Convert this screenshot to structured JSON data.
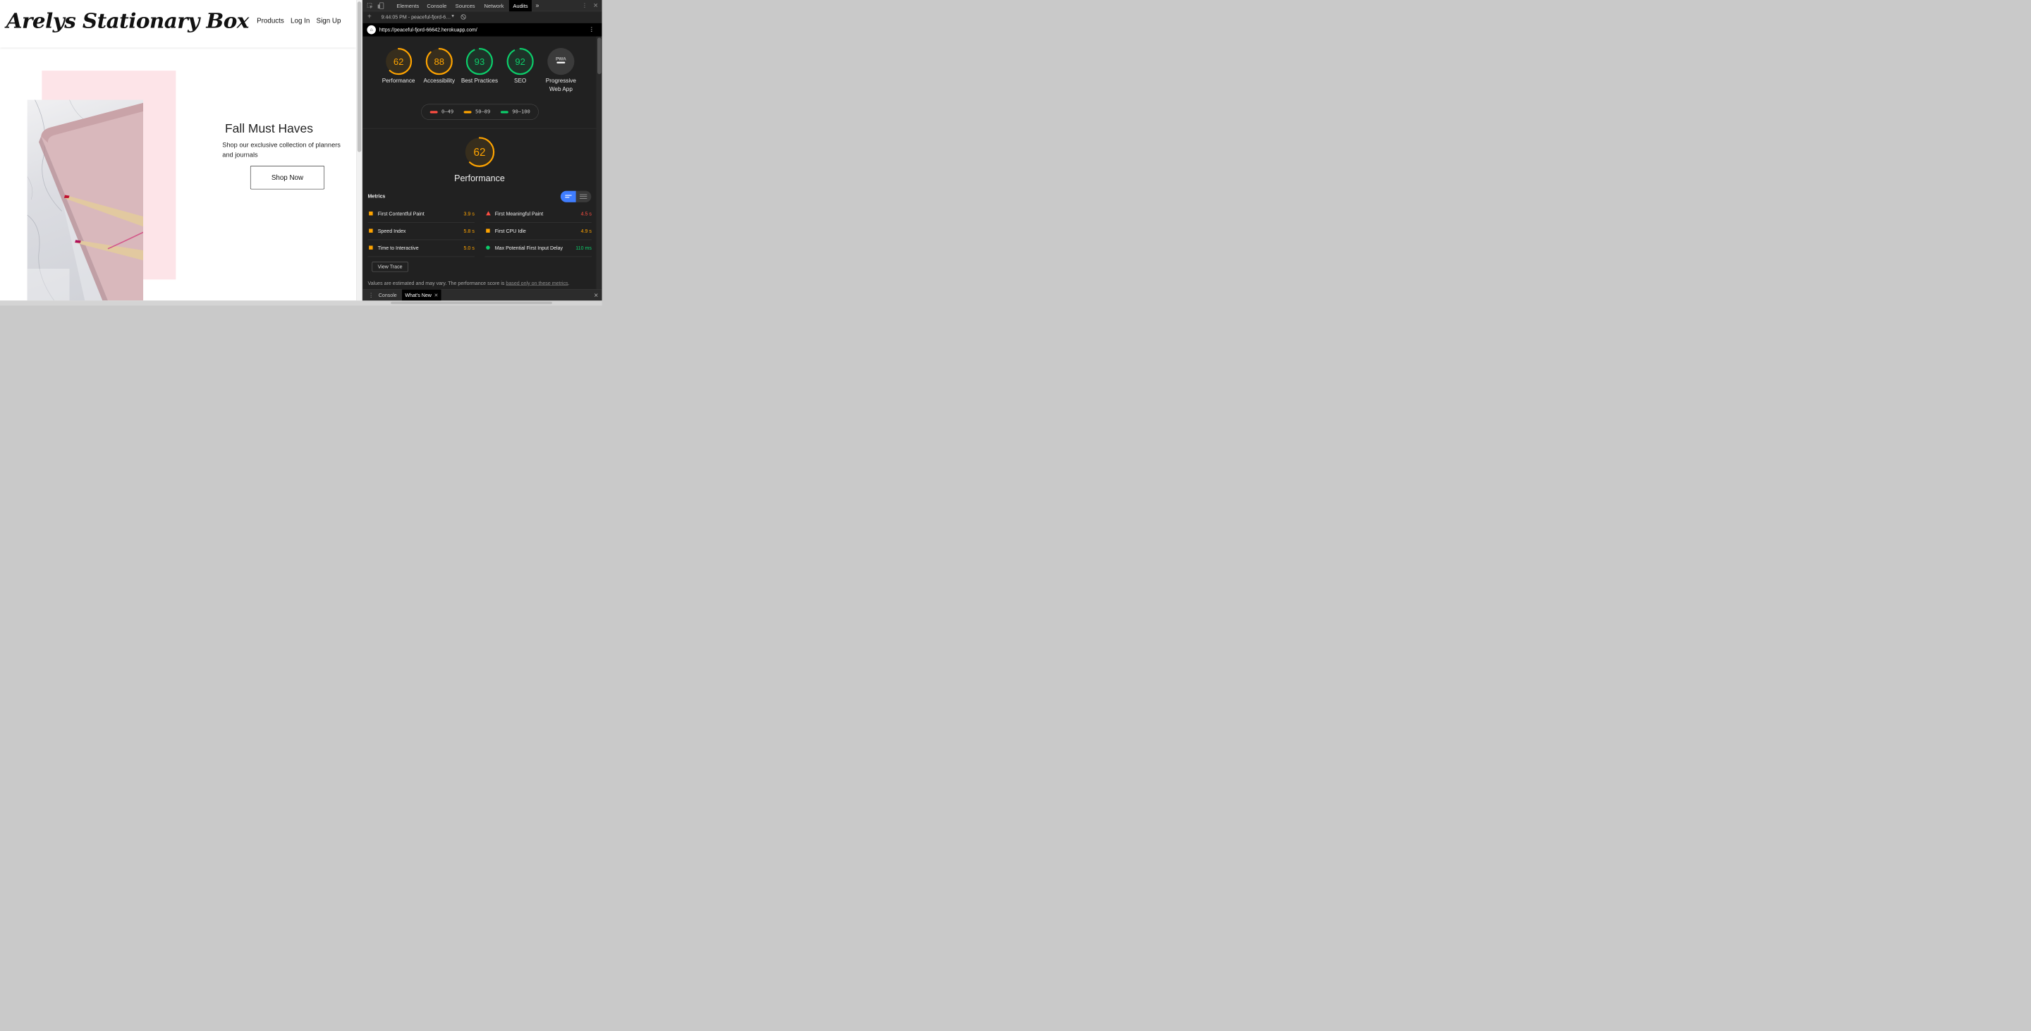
{
  "site": {
    "brand": "Arelys Stationary Box",
    "nav": [
      "Products",
      "Log In",
      "Sign Up"
    ],
    "hero": {
      "title": "Fall Must Haves",
      "subtitle": "Shop our exclusive collection of planners and journals",
      "button": "Shop Now"
    }
  },
  "devtools": {
    "tabs": [
      "Elements",
      "Console",
      "Sources",
      "Network",
      "Audits"
    ],
    "active_tab": "Audits",
    "more_tabs_glyph": "»",
    "run_label": "9:44:05 PM - peaceful-fjord-6…",
    "url": "https://peaceful-fjord-66642.herokuapp.com/",
    "categories": [
      {
        "label": "Performance",
        "score": 62,
        "color": "#ffa400"
      },
      {
        "label": "Accessibility",
        "score": 88,
        "color": "#ffa400"
      },
      {
        "label": "Best Practices",
        "score": 93,
        "color": "#0cce6b"
      },
      {
        "label": "SEO",
        "score": 92,
        "color": "#0cce6b"
      },
      {
        "label": "Progressive Web App",
        "score": null,
        "badge": "PWA",
        "color": "#9e9e9e"
      }
    ],
    "legend": [
      {
        "range": "0–49",
        "color": "#ff4e42"
      },
      {
        "range": "50–89",
        "color": "#ffa400"
      },
      {
        "range": "90–100",
        "color": "#0cce6b"
      }
    ],
    "performance": {
      "score": 62,
      "label": "Performance",
      "metrics_title": "Metrics",
      "metrics": [
        {
          "name": "First Contentful Paint",
          "value": "3.9 s",
          "rating": "average"
        },
        {
          "name": "First Meaningful Paint",
          "value": "4.5 s",
          "rating": "fail"
        },
        {
          "name": "Speed Index",
          "value": "5.8 s",
          "rating": "average"
        },
        {
          "name": "First CPU Idle",
          "value": "4.9 s",
          "rating": "average"
        },
        {
          "name": "Time to Interactive",
          "value": "5.0 s",
          "rating": "average"
        },
        {
          "name": "Max Potential First Input Delay",
          "value": "110 ms",
          "rating": "pass"
        }
      ],
      "view_trace": "View Trace",
      "note_prefix": "Values are estimated and may vary. The performance score is ",
      "note_link": "based only on these metrics",
      "note_suffix": "."
    },
    "drawer_tabs": [
      "Console",
      "What's New"
    ],
    "active_drawer_tab": "What's New"
  },
  "colors": {
    "pass": "#0cce6b",
    "average": "#ffa400",
    "fail": "#ff4e42",
    "accent": "#3f7dff"
  }
}
